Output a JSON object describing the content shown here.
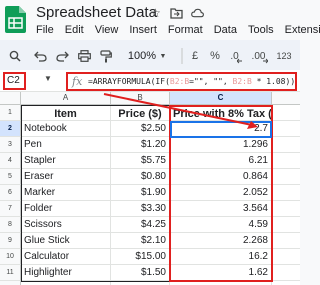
{
  "app": {
    "title": "Spreadsheet Data",
    "menu": [
      "File",
      "Edit",
      "View",
      "Insert",
      "Format",
      "Data",
      "Tools",
      "Extensio"
    ]
  },
  "toolbar": {
    "zoom": "100%",
    "currency": "£",
    "percent": "%",
    "decrease_decimal": ".0",
    "increase_decimal": ".00",
    "number_format": "123"
  },
  "formula_bar": {
    "name_box": "C2",
    "fx": "fx",
    "formula_parts": [
      "=ARRAYFORMULA(IF(",
      "B2:B",
      "=\"\", \"\", ",
      "B2:B",
      " * 1.08))"
    ]
  },
  "sheet": {
    "columns": [
      "A",
      "B",
      "C"
    ],
    "row_numbers": [
      "1",
      "2",
      "3",
      "4",
      "5",
      "6",
      "7",
      "8",
      "9",
      "10",
      "11",
      "12"
    ],
    "headers": [
      "Item",
      "Price ($)",
      "Price with 8% Tax ($)"
    ],
    "rows": [
      [
        "Notebook",
        "$2.50",
        "2.7"
      ],
      [
        "Pen",
        "$1.20",
        "1.296"
      ],
      [
        "Stapler",
        "$5.75",
        "6.21"
      ],
      [
        "Eraser",
        "$0.80",
        "0.864"
      ],
      [
        "Marker",
        "$1.90",
        "2.052"
      ],
      [
        "Folder",
        "$3.30",
        "3.564"
      ],
      [
        "Scissors",
        "$4.25",
        "4.59"
      ],
      [
        "Glue Stick",
        "$2.10",
        "2.268"
      ],
      [
        "Calculator",
        "$15.00",
        "16.2"
      ],
      [
        "Highlighter",
        "$1.50",
        "1.62"
      ]
    ]
  },
  "colors": {
    "highlight": "#e0201f",
    "selection": "#1a73e8"
  }
}
